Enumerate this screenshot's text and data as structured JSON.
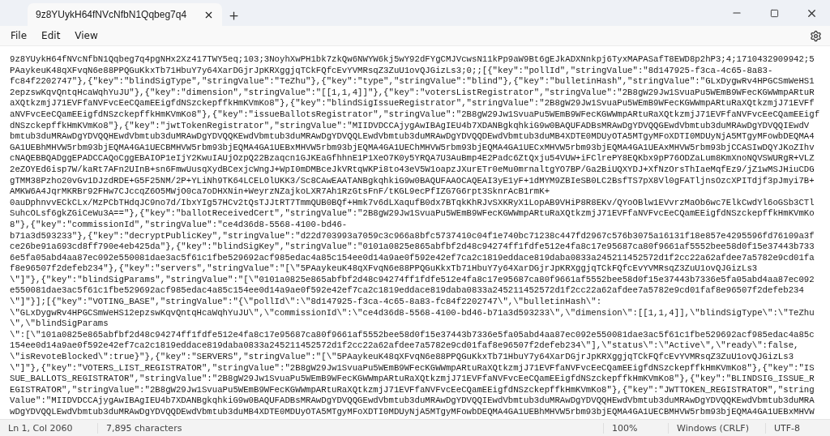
{
  "window": {
    "tab_title": "9z8YUykH64fNVcNfbN1Qqbeg7q4"
  },
  "menu": [
    "File",
    "Edit",
    "View"
  ],
  "document": {
    "lines": [
      "9z8YUykH64fNVcNfbN1Qqbeg7q4pgNHx2Xz417TWY5eq;103;3NoyhXwPH1bk7zkQw6NWYW6kj5wY92dFYgCMJVcwsN11kPp9aW9Bt6gEJkADXNnkpj6TyxMAPASafT8EWD8p2hP3;4;1710432909942;5",
      "PAaykeuK48qXFvqN6e88PPQGuKkxTb71HbuY7y64XarDGjrJpKRXggjqTCkFQfcEvYVMRsqZ3ZuU1ovQJGizLs3;0;;[{\"key\":\"pollId\",\"stringValue\":\"8d147925-f3ca-4c65-8a83-",
      "fc84f2202747\"},{\"key\":\"blindSigType\",\"stringValue\":\"TeZhu\"},{\"key\":\"type\",\"stringValue\":\"blind\"},{\"key\":\"bulletinHash\",\"stringValue\":\"GLxDygwRv4HPGCSmWeHS1",
      "2epzswKqvQntqHcaWqhYuJU\"},{\"key\":\"dimension\",\"stringValue\":\"[[1,1,4]]\"},{\"key\":\"votersListRegistrator\",\"stringValue\":\"2B8gW29Jw1SvuaPu5WEmB9WFecKGWWmpARtuR",
      "aXQtkzmjJ71EVFfaNVFvcEeCQamEEigfdNSzckepffkHmKVmKo8\"},{\"key\":\"blindSigIssueRegistrator\",\"stringValue\":\"2B8gW29Jw1SvuaPu5WEmB9WFecKGWWmpARtuRaXQtkzmjJ71EVFf",
      "aNVFvcEeCQamEEigfdNSzckepffkHmKVmKo8\"},{\"key\":\"issueBallotsRegistrator\",\"stringValue\":\"2B8gW29Jw1SvuaPu5WEmB9WFecKGWWmpARtuRaXQtkzmjJ71EVFfaNVFvcEeCQamEEigf",
      "dNSzckepffkHmKVmKo8\"},{\"key\":\"jwtTokenRegistrator\",\"stringValue\":\"MIIDVDCCAjygAwIBAgIEU4b7XDANBgkqhkiG9w0BAQUFADBsMRAwDgYDVQQGEwdVbmtub3duMRAwDgYDVQQIEwdV",
      "bmtub3duMRAwDgYDVQQHEwdVbmtub3duMRAwDgYDVQQKEwdVbmtub3duMRAwDgYDVQQLEwdVbmtub3duMRAwDgYDVQQDEwdVbmtub3duMB4XDTE0MDUyOTA5MTgyMFoXDTI0MDUyNjA5MTgyMFowbDEQMA4",
      "GA1UEBhMHVW5rbm93bjEQMA4GA1UECBMHVW5rbm93bjEQMA4GA1UEBxMHVW5rbm93bjEQMA4GA1UEChMHVW5rbm93bjEQMA4GA1UECxMHVW5rbm93bjEQMA4GA1UEAxMHVW5rbm93bjCCASIwDQYJKoZIhv",
      "cNAQEBBQADggEPADCCAQoCggEBAIOP1eIjY2KwuIAUjOzpQ22Bzaqcn1GJKEaGfhhnE1P1XeO7K0y5YRQA7U3AuBmp4E2Padc6ZtQxju54VUW+iFClrePY8EQKbx9pP76ODZaLum8KmXnoNQVSWURgR+VLZ",
      "2eZOYEd6isp7W/kaRt7AFn2UInB+sn6FmwUusqXydBCexjcWngJ+WpI0mDMBceJkVRtqWKPi8to43eV5W1oapzJXurETr0eMu0mrnaltgYO7BP/Ga2BiUQXYDJ+XfNzOrsThIaeMqfEz9/jZ1wMSJHiuCDG",
      "gTMM38Pzho20vGv1DJzdRDE+G5F25NM/2P+YLiNh9TK64LCELOlUKK3/Sc8CAwEAATANBgkqhkiG9w0BAQUFAAOCAQEAI3yE1yF+1dMYM9ZBIeSB0LC2BsfTS7pX8Vl0gFATljnsOzcXPITdjf3pJmyi7B+",
      "AMKW6A4JqrMKRBr92FHw7CJccqZ6O5MWjO0ca7oDHXNin+WeyrzNZajkoLXR7Ah1RzGtsFnF/tKGL9ecPfIZG7G6rpt3SknrAcB1rmK+",
      "0auDphnvvECkCLx/MzPCbTHdqJC9no7d/IbxYIg57HCv2tQsTJJtRT7TmmQUB0BQf+Hmk7v6dLXaqufB0dx7BTqkKhRJvSXKRyX1LopAB9VHiP8R8EKv/QYoOBlw1EVvrzMaOb6wc7ElkCwdYl6oGSb3CTl",
      "SuhcOLsf6gkZGiCeWu3A==\"},{\"key\":\"ballotReceivedCert\",\"stringValue\":\"2B8gW29Jw1SvuaPu5WEmB9WFecKGWWmpARtuRaXQtkzmjJ71EVFfaNVFvcEeCQamEEigfdNSzckepffkHmKVmKo",
      "8\"},{\"key\":\"commissionId\",\"stringValue\":\"ce4d36d8-5568-4100-bd46-",
      "b71a3d593233\"},{\"key\":\"decryptPublicKey\",\"stringValue\":\"d22d703993a7059c3c966a8bfc5737410c04f1e740bc71238c447fd2967c576b3075a16131f18e857e4295596fd76109a3f",
      "ce26be91a693cd8ff790e4eb425da\"},{\"key\":\"blindSigKey\",\"stringValue\":\"0101a0825e865abfbf2d48c94274ff1fdfe512e4fa8c17e95687ca80f9661af5552bee58d0f15e37443b733",
      "6e5fa05abd4aa87ec092e550081dae3ac5f61c1fbe529692acf985edac4a85c154ee0d14a9ae0f592e42ef7ca2c1819eddace819daba0833a245211452572d1f2cc22a62afdee7a5782e9cd01fa",
      "f8e96507f2defeb234\"},{\"key\":\"servers\",\"stringValue\":\"[\\\"5PAaykeuK48qXFvqN6e88PPQGuKkxTb71HbuY7y64XarDGjrJpKRXggjqTCkFQfcEvYVMRsqZ3ZuU1ovQJGizLs3",
      "\\\"]\"},{\"key\":\"blindSigParams\",\"stringValue\":\"[\\\"0101a0825e865abfbf2d48c94274ff1fdfe512e4fa8c17e95687ca80f9661af5552bee58d0f15e37443b7336e5fa05abd4aa87ec092",
      "e550081dae3ac5f61c1fbe529692acf985edac4a85c154ee0d14a9ae0f592e42ef7ca2c1819eddace819daba0833a245211452572d1f2cc22a62afdee7a5782e9cd01faf8e96507f2defeb234",
      "\\\"]\"}];[{\"key\":\"VOTING_BASE\",\"stringValue\":\"{\\\"pollId\\\":\\\"8d147925-f3ca-4c65-8a83-fc84f2202747\\\",\\\"bulletinHash\\\":",
      "\\\"GLxDygwRv4HPGCSmWeHS12epzswKqvQntqHcaWqhYuJU\\\",\\\"commissionId\\\":\\\"ce4d36d8-5568-4100-bd46-b71a3d593233\\\",\\\"dimension\\\":[[1,1,4]],\\\"blindSigType\\\":\\\"TeZhu",
      "\\\",\\\"blindSigParams",
      "\\\":[\\\"101a0825e865abfbf2d48c94274ff1fdfe512e4fa8c17e95687ca80f9661af5552bee58d0f15e37443b7336e5fa05abd4aa87ec092e550081dae3ac5f61c1fbe529692acf985edac4a85c",
      "154ee0d14a9ae0f592e42ef7ca2c1819eddace819daba0833a245211452572d1f2cc22a62afdee7a5782e9cd01faf8e96507f2defeb234\\\"],\\\"status\\\":\\\"Active\\\",\\\"ready\\\":false,",
      "\\\"isRevoteBlocked\\\":true}\"},{\"key\":\"SERVERS\",\"stringValue\":\"[\\\"5PAaykeuK48qXFvqN6e88PPQGuKkxTb71HbuY7y64XarDGjrJpKRXggjqTCkFQfcEvYVMRsqZ3ZuU1ovQJGizLs3",
      "\\\"]\"},{\"key\":\"VOTERS_LIST_REGISTRATOR\",\"stringValue\":\"2B8gW29Jw1SvuaPu5WEmB9WFecKGWWmpARtuRaXQtkzmjJ71EVFfaNVFvcEeCQamEEigfdNSzckepffkHmKVmKo8\"},{\"key\":\"IS",
      "SUE_BALLOTS_REGISTRATOR\",\"stringValue\":\"2B8gW29Jw1SvuaPu5WEmB9WFecKGWWmpARtuRaXQtkzmjJ71EVFfaNVFvcEeCQamEEigfdNSzckepffkHmKVmKo8\"},{\"key\":\"BLINDSIG_ISSUE_R",
      "EGISTRATOR\",\"stringValue\":\"2B8gW29Jw1SvuaPu5WEmB9WFecKGWWmpARtuRaXQtkzmjJ71EVFfaNVFvcEeCQamEEigfdNSzckepffkHmKVmKo8\"},{\"key\":\"JWTTOKEN_REGISTRATOR\",\"string",
      "Value\":\"MIIDVDCCAjygAwIBAgIEU4b7XDANBgkqhkiG9w0BAQUFADBsMRAwDgYDVQQGEwdVbmtub3duMRAwDgYDVQQIEwdVbmtub3duMRAwDgYDVQQHEwdVbmtub3duMRAwDgYDVQQKEwdVbmtub3duMRA",
      "wDgYDVQQLEwdVbmtub3duMRAwDgYDVQQDEwdVbmtub3duMB4XDTE0MDUyOTA5MTgyMFoXDTI0MDUyNjA5MTgyMFowbDEQMA4GA1UEBhMHVW5rbm93bjEQMA4GA1UECBMHVW5rbm93bjEQMA4GA1UEBxMHVW"
    ]
  },
  "status_bar": {
    "position": "Ln 1, Col 2060",
    "characters": "7,895 characters",
    "zoom": "100%",
    "line_ending": "Windows (CRLF)",
    "encoding": "UTF-8"
  }
}
